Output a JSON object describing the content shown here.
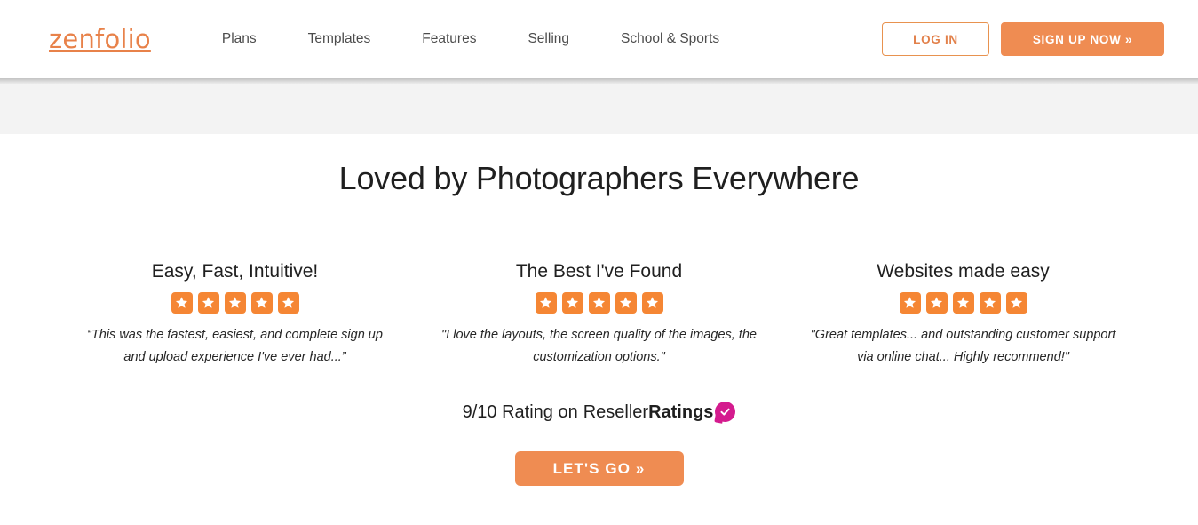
{
  "header": {
    "logo_text": "zenfolio",
    "nav": [
      {
        "label": "Plans"
      },
      {
        "label": "Templates"
      },
      {
        "label": "Features"
      },
      {
        "label": "Selling"
      },
      {
        "label": "School & Sports"
      }
    ],
    "login_label": "LOG IN",
    "signup_label": "SIGN UP NOW »"
  },
  "section": {
    "title": "Loved by Photographers Everywhere",
    "testimonials": [
      {
        "title": "Easy, Fast, Intuitive!",
        "stars": 5,
        "quote": "“This was the fastest, easiest, and complete sign up and upload experience I've ever had...”"
      },
      {
        "title": "The Best I've Found",
        "stars": 5,
        "quote": "\"I love the layouts, the screen quality of the images, the customization options.\""
      },
      {
        "title": "Websites made easy",
        "stars": 5,
        "quote": "\"Great templates... and outstanding customer support via online chat... Highly recommend!\""
      }
    ],
    "rating": {
      "prefix": "9/10 Rating on",
      "brand_light": "Reseller",
      "brand_bold": "Ratings",
      "badge_icon": "check-badge-icon"
    },
    "cta_label": "LET'S GO »"
  },
  "colors": {
    "brand_orange": "#e8824a",
    "button_orange": "#ef8c52",
    "star_orange": "#f58634",
    "badge_magenta": "#d41b8e",
    "band_gray": "#f3f3f3",
    "nav_text": "#4c4c4c"
  }
}
